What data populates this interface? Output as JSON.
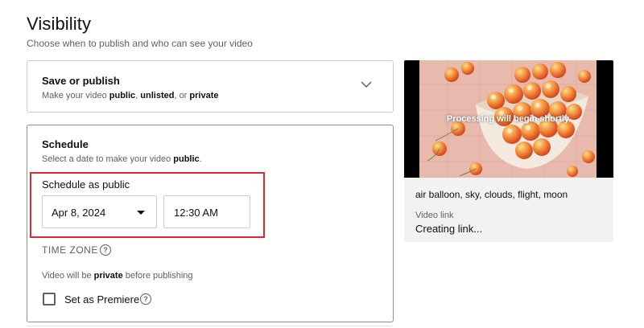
{
  "page": {
    "title": "Visibility",
    "subtitle": "Choose when to publish and who can see your video"
  },
  "save_publish": {
    "title": "Save or publish",
    "desc_prefix": "Make your video ",
    "opt_public": "public",
    "sep1": ", ",
    "opt_unlisted": "unlisted",
    "sep2": ", or ",
    "opt_private": "private",
    "chevron_icon": "chevron-down-icon"
  },
  "schedule": {
    "title": "Schedule",
    "desc_prefix": "Select a date to make your video ",
    "desc_bold": "public",
    "desc_suffix": ".",
    "schedule_label": "Schedule as public",
    "date_value": "Apr 8, 2024",
    "time_value": "12:30 AM",
    "timezone_label": "TIME ZONE",
    "help_glyph": "?",
    "private_prefix": "Video will be ",
    "private_bold": "private",
    "private_suffix": " before publishing",
    "premiere_label": "Set as Premiere",
    "premiere_checked": false,
    "highlight_color": "#e0262e"
  },
  "preview": {
    "processing_text": "Processing will begin shortly",
    "video_title": "air balloon, sky, clouds, flight, moon",
    "link_label": "Video link",
    "link_value": "Creating link..."
  }
}
